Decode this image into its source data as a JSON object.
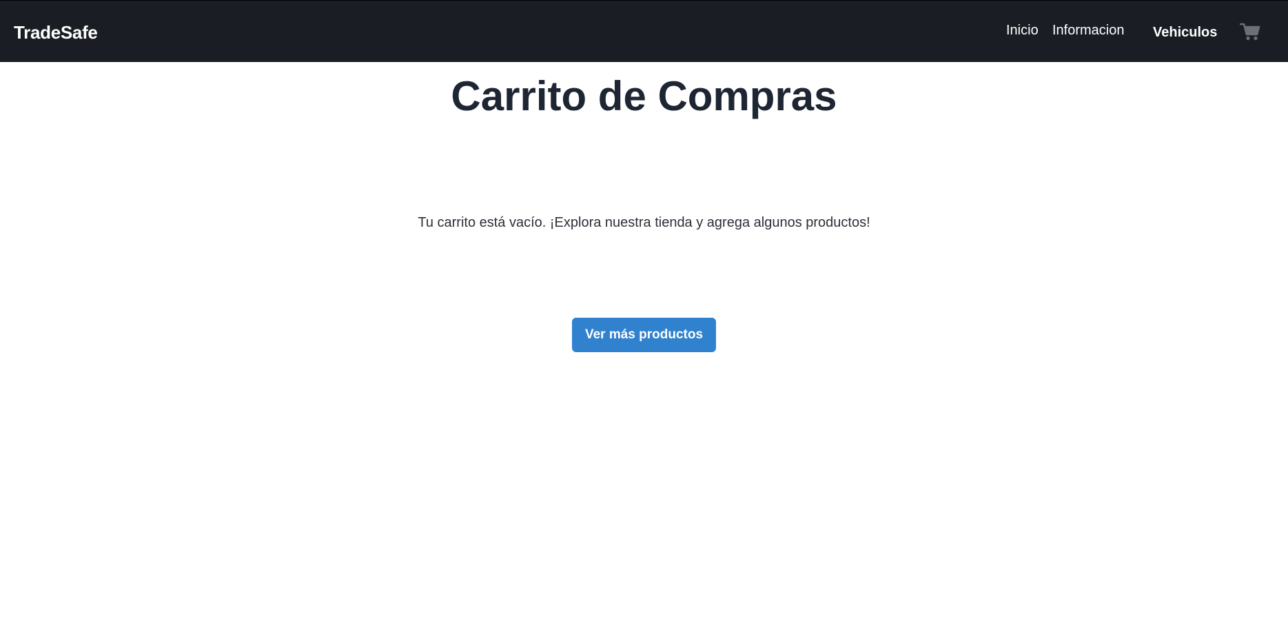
{
  "nav": {
    "brand": "TradeSafe",
    "links": [
      "Inicio",
      "Informacion",
      "Vehiculos"
    ],
    "cart_icon": "shopping-cart-icon"
  },
  "main": {
    "title": "Carrito de Compras",
    "empty_message": "Tu carrito está vacío. ¡Explora nuestra tienda y agrega algunos productos!",
    "cta_label": "Ver más productos"
  },
  "colors": {
    "navbar_bg": "#1a1d24",
    "title_text": "#1e2533",
    "cta_bg": "#3182ce",
    "cart_icon": "#6b6f77"
  }
}
